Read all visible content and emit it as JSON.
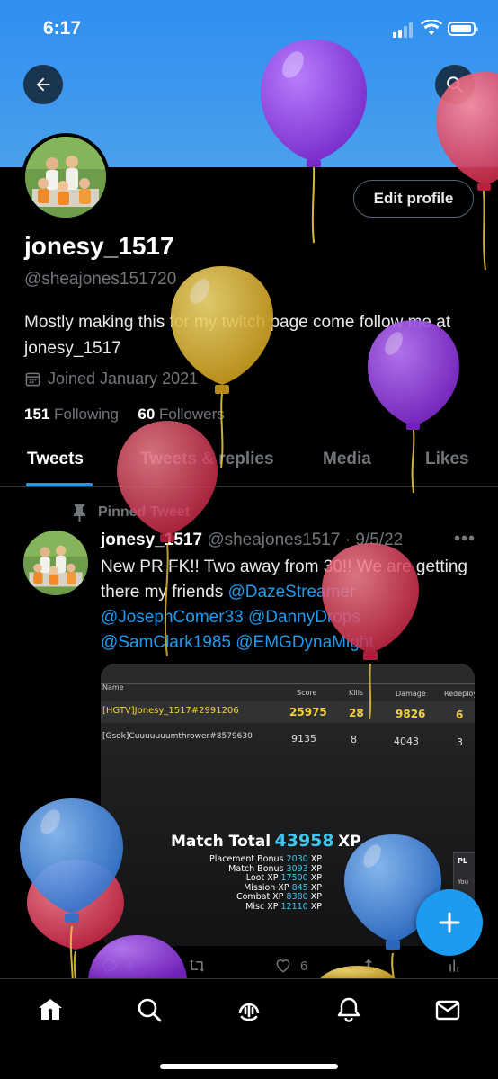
{
  "status_bar": {
    "time": "6:17"
  },
  "profile": {
    "edit_profile_label": "Edit profile",
    "display_name": "jonesy_1517",
    "handle": "@sheajones151720",
    "bio": "Mostly making this for my twitch page come follow me at jonesy_1517",
    "joined": "Joined January 2021",
    "following_count": "151",
    "following_label": "Following",
    "followers_count": "60",
    "followers_label": "Followers"
  },
  "tabs": [
    {
      "label": "Tweets",
      "active": true
    },
    {
      "label": "Tweets & replies",
      "active": false
    },
    {
      "label": "Media",
      "active": false
    },
    {
      "label": "Likes",
      "active": false
    }
  ],
  "tweet": {
    "pinned_label": "Pinned Tweet",
    "author_name": "jonesy_1517",
    "author_handle": "@sheajones1517",
    "separator": "·",
    "date": "9/5/22",
    "text": "New PR FK!! Two away from 30!! We are getting there my friends",
    "mentions": [
      "@DazeStreamer",
      "@JosephComer33",
      "@DannyDrops",
      "@SamClark1985",
      "@EMGDynaMight"
    ],
    "reply_count": "4",
    "like_count": "6",
    "media": {
      "columns": [
        "Name",
        "Score",
        "Kills",
        "Damage",
        "Redeploy"
      ],
      "rows": [
        {
          "name": "[HGTV]Jonesy_1517#2991206",
          "score": "25975",
          "kills": "28",
          "damage": "9826",
          "redeploy": "6",
          "highlight": true
        },
        {
          "name": "[Gsok]Cuuuuuuumthrower#8579630",
          "score": "9135",
          "kills": "8",
          "damage": "4043",
          "redeploy": "3",
          "highlight": false
        }
      ],
      "match_total_label": "Match Total",
      "match_total_value": "43958",
      "xp_unit": "XP",
      "bonuses": [
        {
          "label": "Placement Bonus",
          "value": "2030"
        },
        {
          "label": "Match Bonus",
          "value": "3093"
        },
        {
          "label": "Loot XP",
          "value": "17500"
        },
        {
          "label": "Mission XP",
          "value": "845"
        },
        {
          "label": "Combat XP",
          "value": "8380"
        },
        {
          "label": "Misc XP",
          "value": "12110"
        }
      ],
      "side_panel_text": [
        "PL",
        "You"
      ]
    }
  },
  "colors": {
    "accent": "#1d9bf0",
    "background": "#000000",
    "secondary_text": "#71767b",
    "banner": "#3d97ee",
    "scoreboard_highlight": "#f5d142",
    "scoreboard_value": "#3ec6f0"
  },
  "icons": {
    "back": "arrow-left-icon",
    "search": "search-icon",
    "calendar": "calendar-icon",
    "pin": "pin-icon",
    "more": "more-horizontal-icon",
    "reply": "reply-icon",
    "retweet": "retweet-icon",
    "like": "heart-icon",
    "share": "share-icon",
    "analytics": "analytics-icon",
    "compose": "plus-icon",
    "nav": [
      "home-icon",
      "explore-search-icon",
      "spaces-icon",
      "notifications-bell-icon",
      "messages-envelope-icon"
    ]
  },
  "decorations": {
    "balloon_colors": [
      "#9b42e8",
      "#e0455e",
      "#e2bd36",
      "#4a8fde"
    ]
  }
}
